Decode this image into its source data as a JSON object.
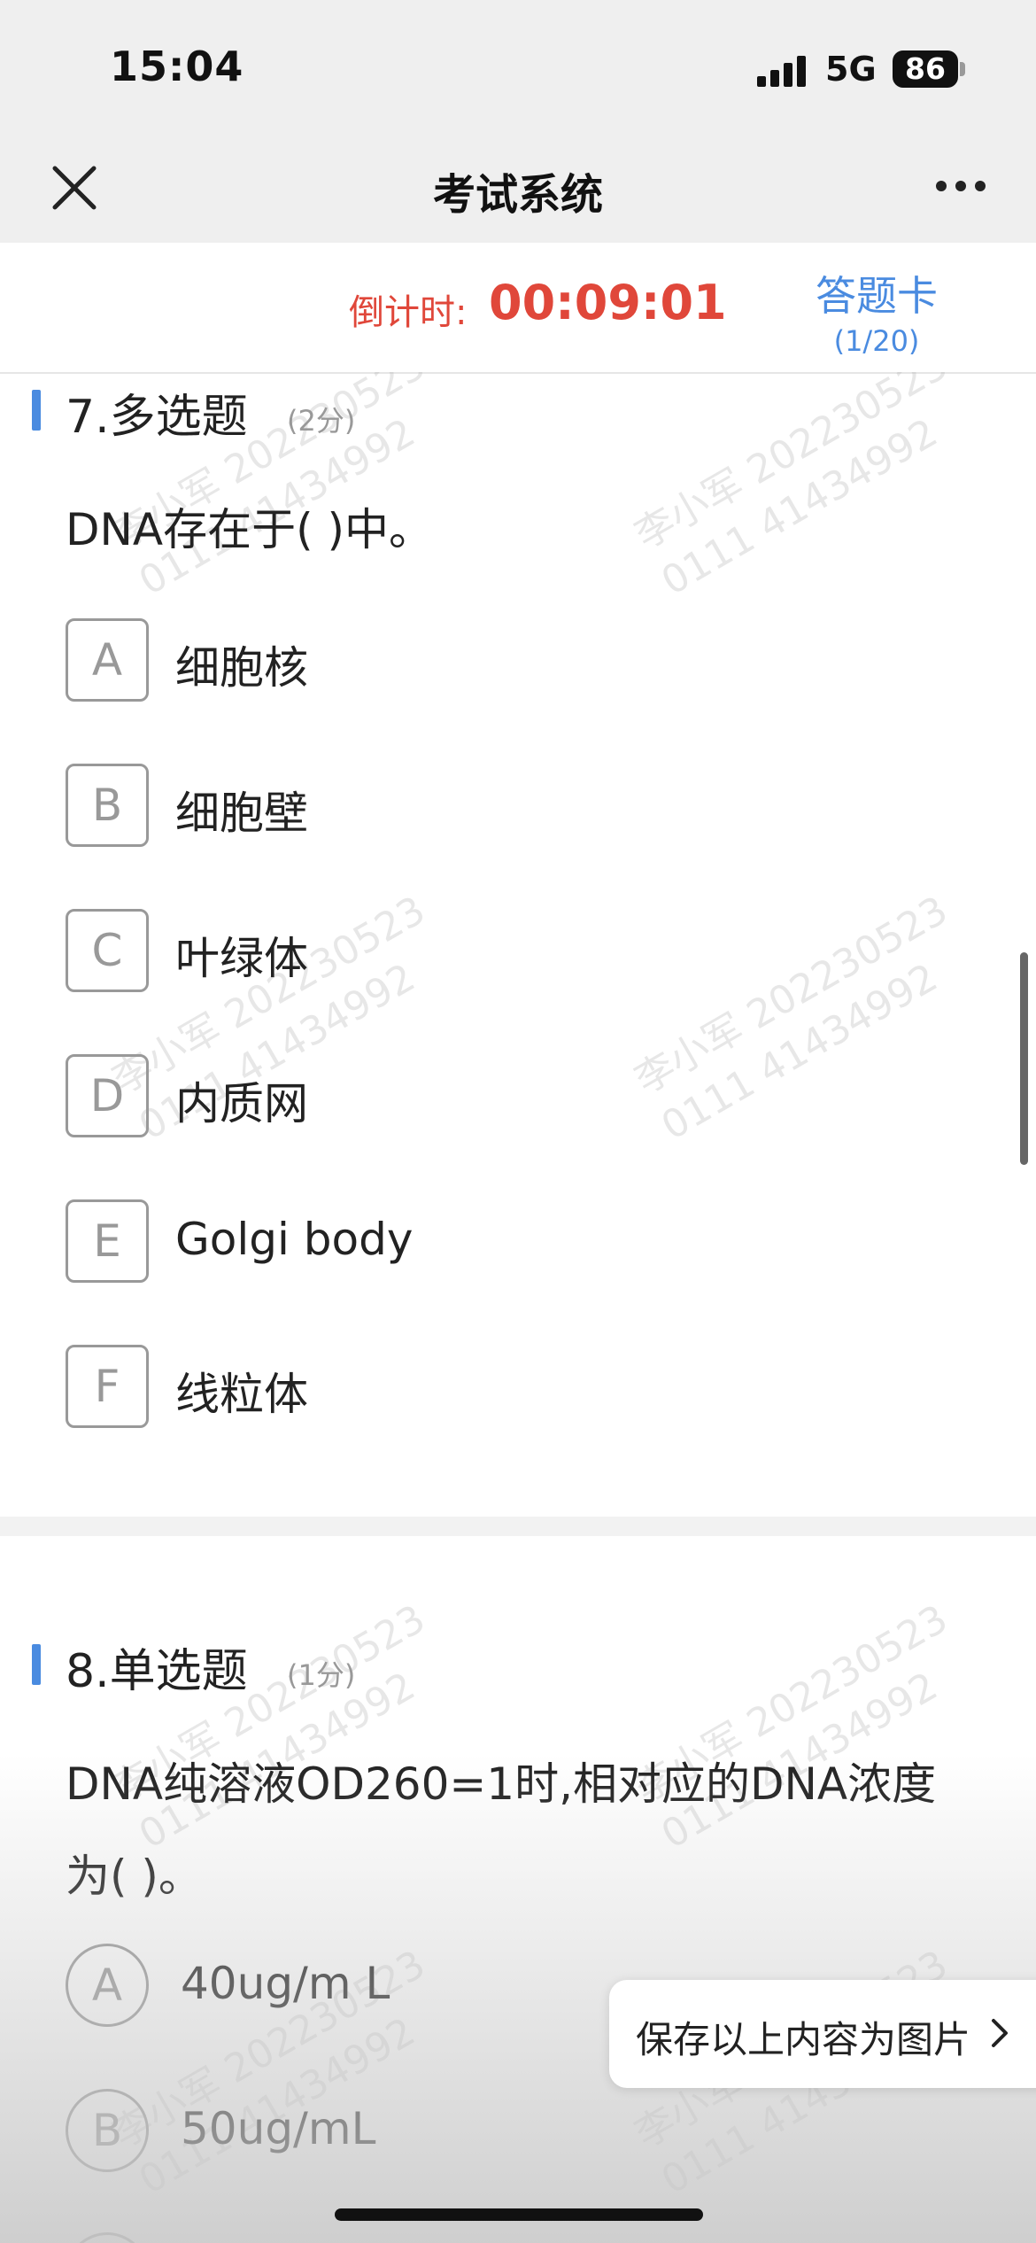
{
  "status_bar": {
    "time": "15:04",
    "network": "5G",
    "battery": "86"
  },
  "nav": {
    "close_icon": "close-icon",
    "title": "考试系统",
    "more_icon": "more-dots-icon"
  },
  "timer": {
    "label": "倒计时:",
    "value": "00:09:01"
  },
  "answer_card": {
    "label": "答题卡",
    "progress": "(1/20)"
  },
  "watermark": {
    "line1": "李小军 202230523",
    "line2": "0111 41434992"
  },
  "questions": [
    {
      "title": "7.多选题",
      "score": "(2分)",
      "text": "DNA存在于(      )中。",
      "options": [
        {
          "key": "A",
          "text": "细胞核"
        },
        {
          "key": "B",
          "text": "细胞壁"
        },
        {
          "key": "C",
          "text": "叶绿体"
        },
        {
          "key": "D",
          "text": "内质网"
        },
        {
          "key": "E",
          "text": "Golgi body"
        },
        {
          "key": "F",
          "text": "线粒体"
        }
      ]
    },
    {
      "title": "8.单选题",
      "score": "(1分)",
      "text": "DNA纯溶液OD260=1时,相对应的DNA浓度为(     )。",
      "options": [
        {
          "key": "A",
          "text": "40ug/m L"
        },
        {
          "key": "B",
          "text": "50ug/mL"
        }
      ]
    }
  ],
  "save_button": {
    "label": "保存以上内容为图片"
  },
  "colors": {
    "accent": "#4a8be0",
    "timer": "#e0473a",
    "option_border": "#999999"
  }
}
